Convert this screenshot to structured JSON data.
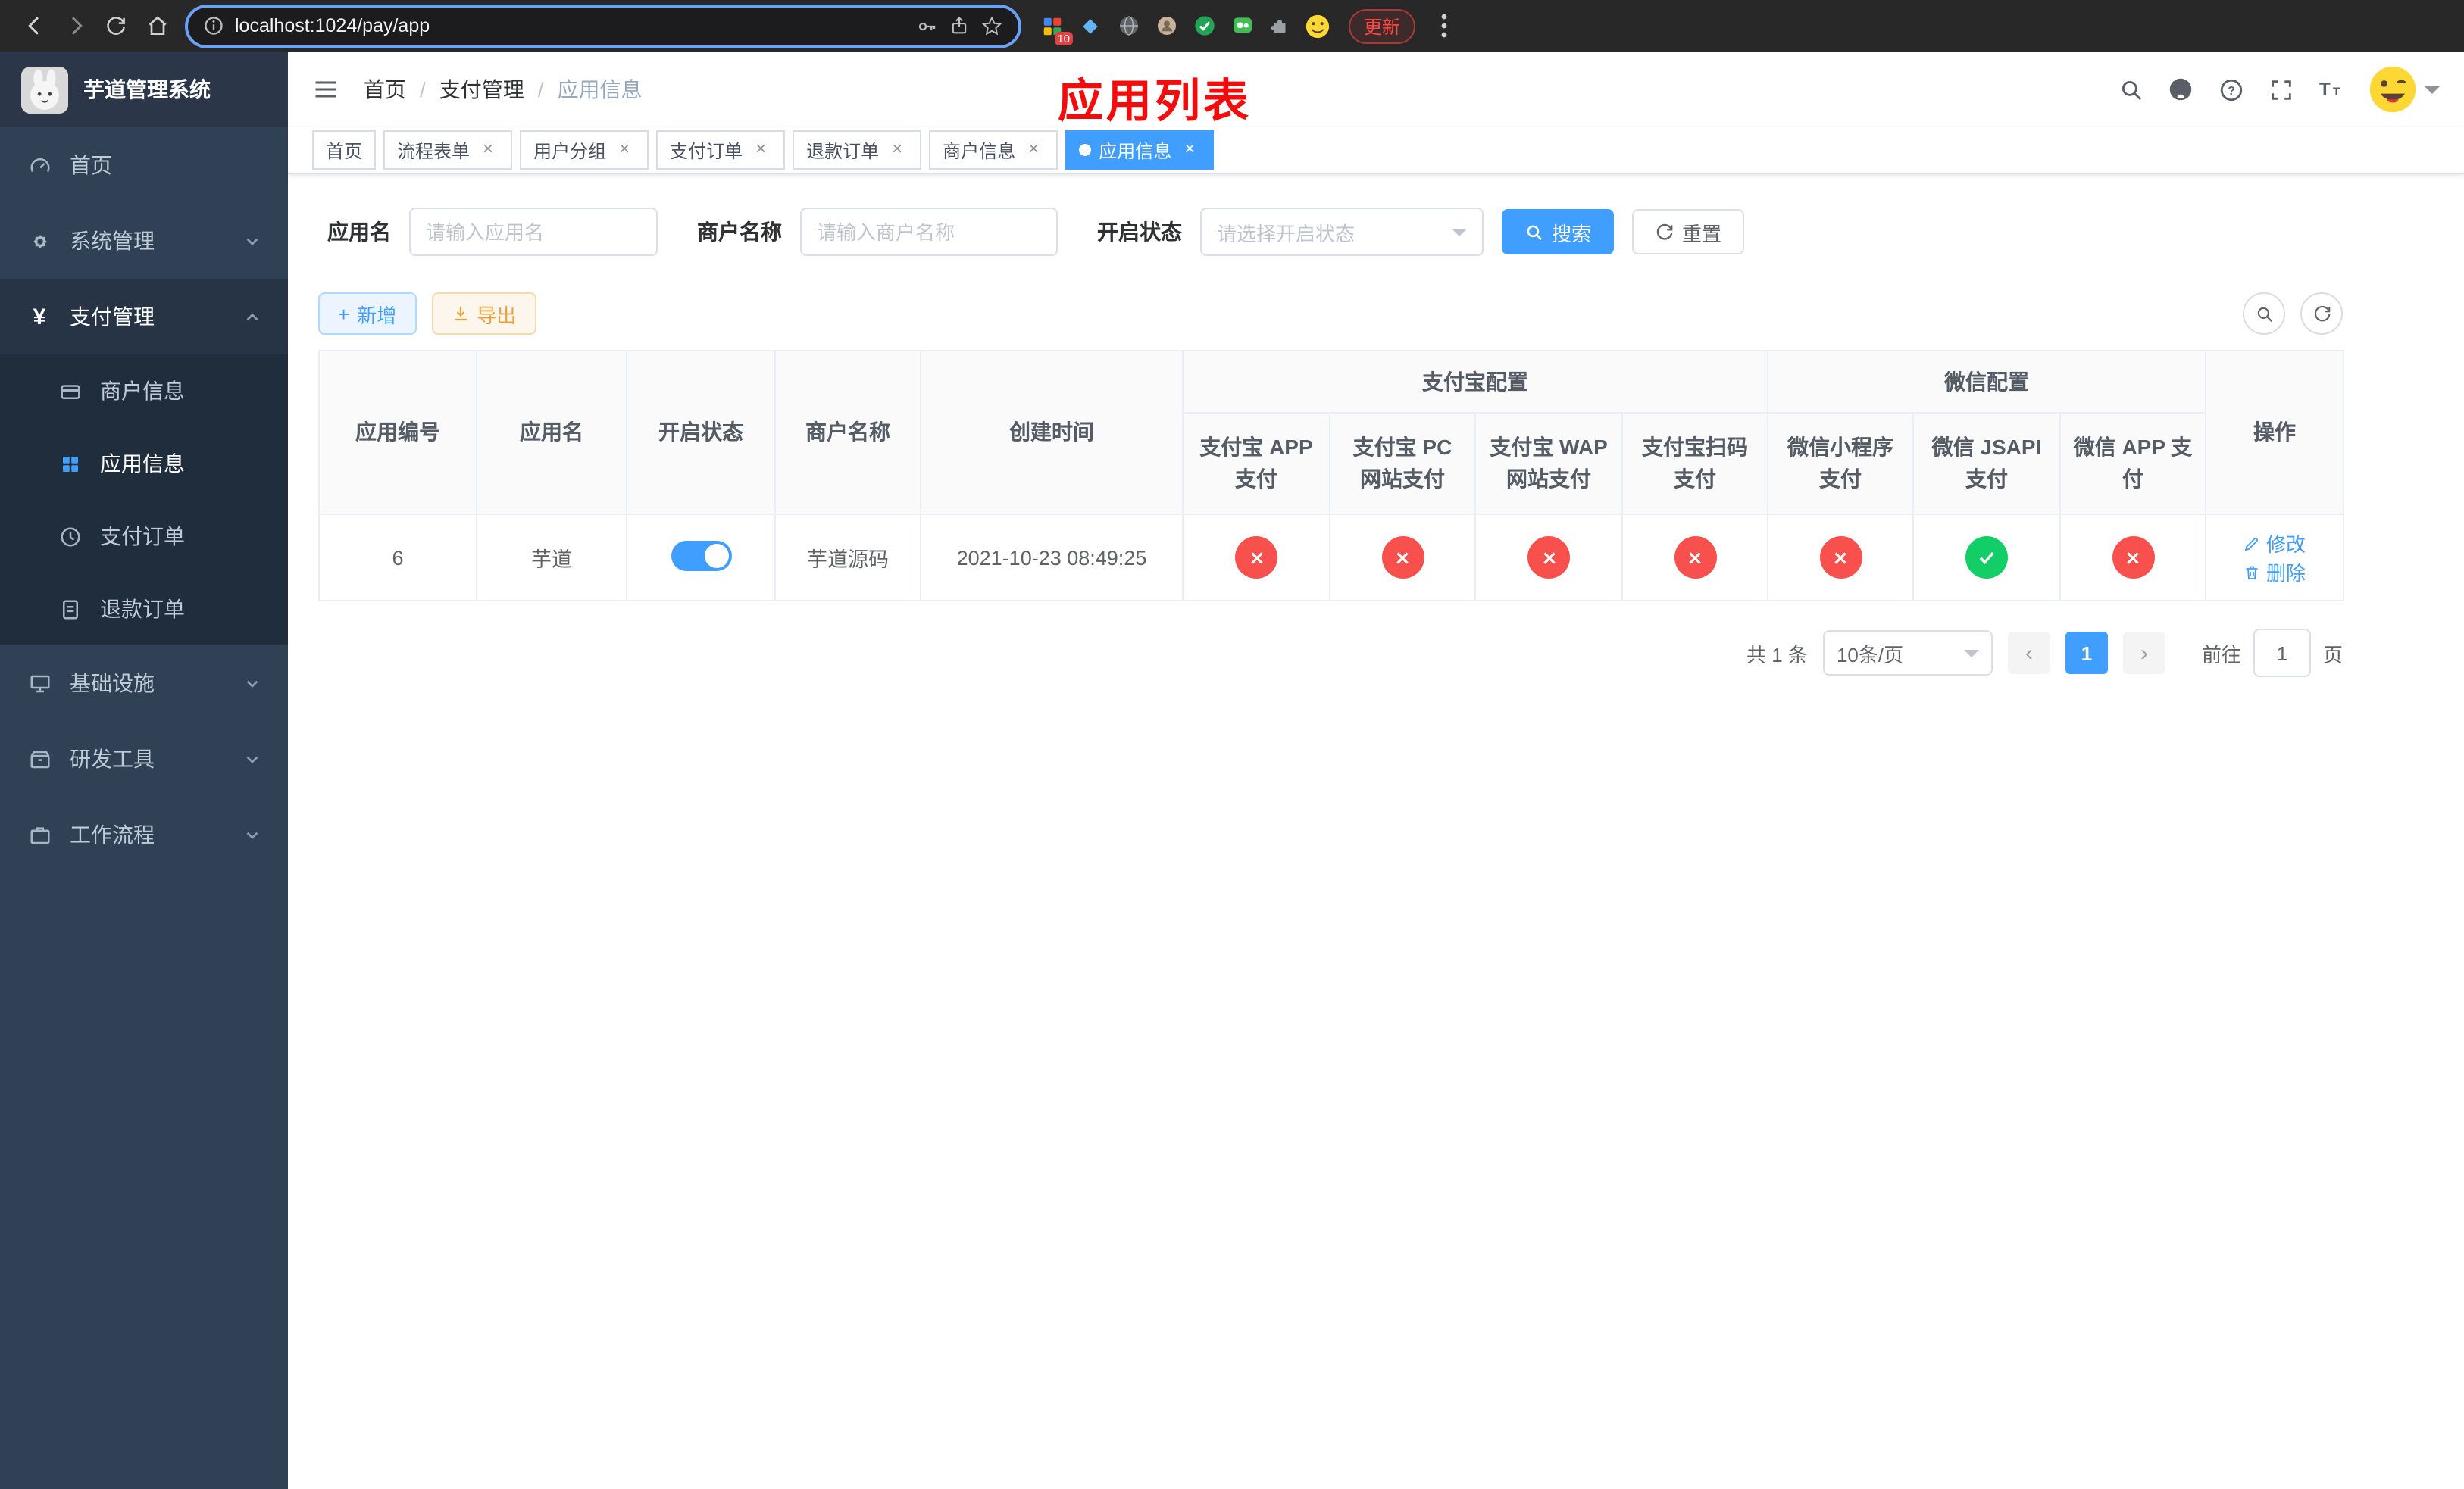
{
  "colors": {
    "accent": "#409eff",
    "annotation_red": "#f40b0b",
    "success_green": "#13ce66",
    "danger_red": "#f7504d",
    "sidebar_bg": "#304156",
    "submenu_bg": "#1f2d3d"
  },
  "browser": {
    "url": "localhost:1024/pay/app",
    "update_label": "更新",
    "extension_badge": "10"
  },
  "sidebar": {
    "title": "芋道管理系统",
    "items": [
      {
        "label": "首页"
      },
      {
        "label": "系统管理"
      },
      {
        "label": "支付管理",
        "children": [
          {
            "label": "商户信息"
          },
          {
            "label": "应用信息"
          },
          {
            "label": "支付订单"
          },
          {
            "label": "退款订单"
          }
        ]
      },
      {
        "label": "基础设施"
      },
      {
        "label": "研发工具"
      },
      {
        "label": "工作流程"
      }
    ]
  },
  "navbar": {
    "breadcrumb": [
      "首页",
      "支付管理",
      "应用信息"
    ],
    "page_annotation": "应用列表"
  },
  "tabs": [
    {
      "label": "首页"
    },
    {
      "label": "流程表单"
    },
    {
      "label": "用户分组"
    },
    {
      "label": "支付订单"
    },
    {
      "label": "退款订单"
    },
    {
      "label": "商户信息"
    },
    {
      "label": "应用信息"
    }
  ],
  "filters": {
    "app_name_label": "应用名",
    "app_name_placeholder": "请输入应用名",
    "merchant_label": "商户名称",
    "merchant_placeholder": "请输入商户名称",
    "status_label": "开启状态",
    "status_placeholder": "请选择开启状态",
    "search_label": "搜索",
    "reset_label": "重置"
  },
  "toolbar": {
    "add_label": "新增",
    "export_label": "导出"
  },
  "table": {
    "headers": {
      "app_id": "应用编号",
      "app_name": "应用名",
      "status": "开启状态",
      "merchant": "商户名称",
      "created": "创建时间",
      "alipay_group": "支付宝配置",
      "wechat_group": "微信配置",
      "actions": "操作",
      "alipay_app": "支付宝 APP 支付",
      "alipay_pc": "支付宝 PC 网站支付",
      "alipay_wap": "支付宝 WAP 网站支付",
      "alipay_qr": "支付宝扫码支付",
      "wx_mini": "微信小程序支付",
      "wx_jsapi": "微信 JSAPI 支付",
      "wx_app": "微信 APP 支付"
    },
    "row": {
      "app_id": "6",
      "app_name": "芋道",
      "enabled": true,
      "merchant": "芋道源码",
      "created": "2021-10-23 08:49:25",
      "alipay_app": false,
      "alipay_pc": false,
      "alipay_wap": false,
      "alipay_qr": false,
      "wx_mini": false,
      "wx_jsapi": true,
      "wx_app": false,
      "edit_label": "修改",
      "delete_label": "删除"
    }
  },
  "pagination": {
    "total_label": "共 1 条",
    "page_size_label": "10条/页",
    "current_page": "1",
    "goto_label": "前往",
    "goto_value": "1",
    "unit_label": "页"
  }
}
